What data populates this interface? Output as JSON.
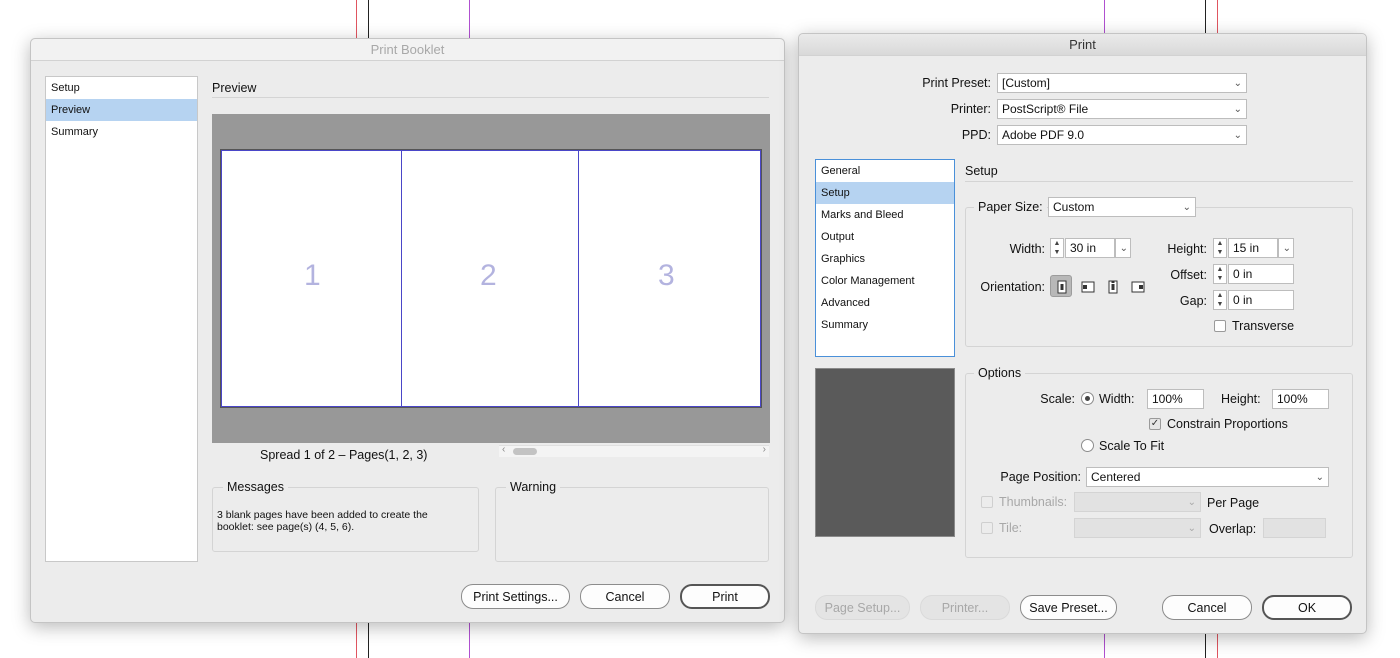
{
  "booklet": {
    "title": "Print Booklet",
    "sidebar": [
      {
        "label": "Setup",
        "selected": false
      },
      {
        "label": "Preview",
        "selected": true
      },
      {
        "label": "Summary",
        "selected": false
      }
    ],
    "section_title": "Preview",
    "pages": [
      "1",
      "2",
      "3"
    ],
    "spread_caption": "Spread 1 of 2 – Pages(1, 2, 3)",
    "messages_title": "Messages",
    "messages_text": "3 blank pages have been added to create the booklet: see page(s) (4, 5, 6).",
    "warning_title": "Warning",
    "buttons": {
      "print_settings": "Print Settings...",
      "cancel": "Cancel",
      "print": "Print"
    },
    "colors": {
      "preview_bg": "#989898",
      "page_divider": "#4a46c8",
      "page_number": "#b3b3df"
    }
  },
  "print": {
    "title": "Print",
    "print_preset_label": "Print Preset:",
    "print_preset_value": "[Custom]",
    "printer_label": "Printer:",
    "printer_value": "PostScript® File",
    "ppd_label": "PPD:",
    "ppd_value": "Adobe PDF 9.0",
    "sidebar": [
      {
        "label": "General",
        "selected": false
      },
      {
        "label": "Setup",
        "selected": true
      },
      {
        "label": "Marks and Bleed",
        "selected": false
      },
      {
        "label": "Output",
        "selected": false
      },
      {
        "label": "Graphics",
        "selected": false
      },
      {
        "label": "Color Management",
        "selected": false
      },
      {
        "label": "Advanced",
        "selected": false
      },
      {
        "label": "Summary",
        "selected": false
      }
    ],
    "setup_title": "Setup",
    "paper_size_label": "Paper Size:",
    "paper_size_value": "Custom",
    "width_label": "Width:",
    "width_value": "30 in",
    "height_label": "Height:",
    "height_value": "15 in",
    "orientation_label": "Orientation:",
    "offset_label": "Offset:",
    "offset_value": "0 in",
    "gap_label": "Gap:",
    "gap_value": "0 in",
    "transverse_label": "Transverse",
    "options_title": "Options",
    "scale_label": "Scale:",
    "scale_width_label": "Width:",
    "scale_width_value": "100%",
    "scale_height_label": "Height:",
    "scale_height_value": "100%",
    "constrain_label": "Constrain Proportions",
    "scale_to_fit_label": "Scale To Fit",
    "page_position_label": "Page Position:",
    "page_position_value": "Centered",
    "thumbnails_label": "Thumbnails:",
    "per_page_label": "Per Page",
    "tile_label": "Tile:",
    "overlap_label": "Overlap:",
    "buttons": {
      "page_setup": "Page Setup...",
      "printer": "Printer...",
      "save_preset": "Save Preset...",
      "cancel": "Cancel",
      "ok": "OK"
    },
    "colors": {
      "preview_box": "#5a5a5a",
      "selection": "#b6d3f1"
    }
  }
}
